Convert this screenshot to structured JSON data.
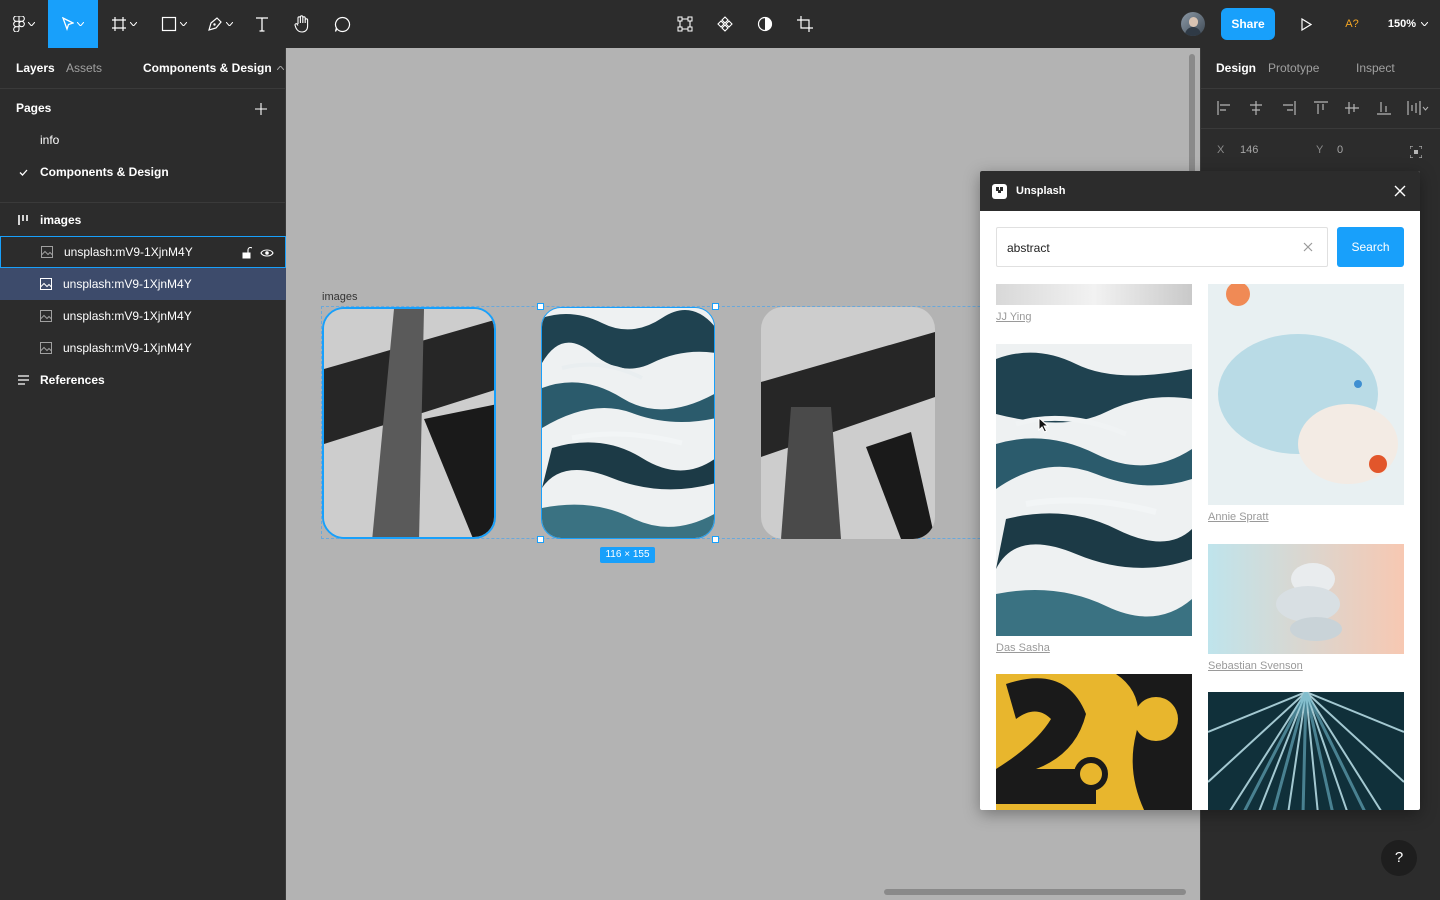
{
  "toolbar": {
    "share_label": "Share",
    "user_initials": "A?",
    "zoom_label": "150%",
    "tools": [
      "figma-menu-icon",
      "move-tool-icon",
      "frame-tool-icon",
      "shape-tool-icon",
      "pen-tool-icon",
      "text-tool-icon",
      "hand-tool-icon",
      "comment-tool-icon"
    ],
    "center_tools": [
      "edit-object-icon",
      "component-icon",
      "mask-icon",
      "crop-icon"
    ]
  },
  "left_panel": {
    "tabs": {
      "layers": "Layers",
      "assets": "Assets",
      "page_switcher": "Components & Design"
    },
    "pages_heading": "Pages",
    "pages": [
      {
        "label": "info",
        "current": false
      },
      {
        "label": "Components & Design",
        "current": true
      }
    ],
    "layers": {
      "frame_name": "images",
      "children": [
        "unsplash:mV9-1XjnM4Y",
        "unsplash:mV9-1XjnM4Y",
        "unsplash:mV9-1XjnM4Y",
        "unsplash:mV9-1XjnM4Y"
      ],
      "references_label": "References"
    }
  },
  "canvas": {
    "frame_label": "images",
    "size_badge": "116 × 155"
  },
  "right_panel": {
    "tabs": {
      "design": "Design",
      "prototype": "Prototype",
      "inspect": "Inspect"
    },
    "x_label": "X",
    "x_value": "146",
    "y_label": "Y",
    "y_value": "0"
  },
  "plugin": {
    "title": "Unsplash",
    "search_value": "abstract",
    "search_button": "Search",
    "results": {
      "left": [
        {
          "author": "JJ Ying"
        },
        {
          "author": "Das Sasha"
        }
      ],
      "right": [
        {
          "author": "Annie Spratt"
        },
        {
          "author": "Sebastian Svenson"
        }
      ]
    }
  },
  "colors": {
    "accent": "#18a0fb",
    "panel_bg": "#2c2c2c",
    "canvas_bg": "#b3b3b3",
    "selection_row": "#3d4b6b",
    "user_color": "#f5a623"
  }
}
